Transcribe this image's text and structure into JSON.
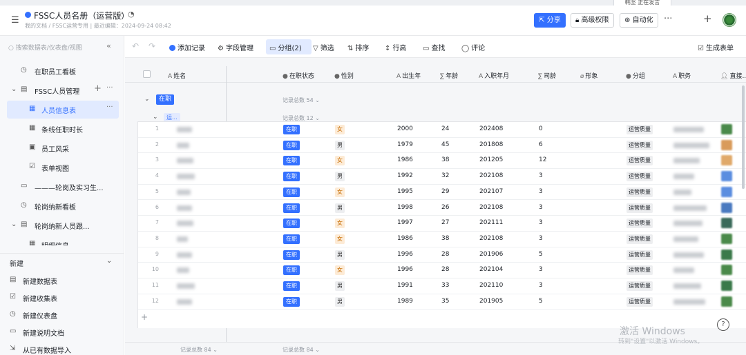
{
  "toast": "韩坚 正在发言",
  "header": {
    "title": "FSSC人员名册（运营版）",
    "breadcrumb": "我的文档 / FSSC运营专用  |  最近编辑：2024-09-24 08:42",
    "share_label": "分享",
    "advanced_perm_label": "高级权限",
    "automation_label": "自动化"
  },
  "sidebar": {
    "search_placeholder": "搜索数据表/仪表盘/视图",
    "items": [
      {
        "label": "在职员工看板",
        "icon": "dashboard-icon"
      },
      {
        "label": "FSSC人员管理",
        "icon": "table-icon"
      },
      {
        "label": "人员信息表",
        "icon": "grid-icon"
      },
      {
        "label": "条线任职时长",
        "icon": "grid-icon"
      },
      {
        "label": "员工风采",
        "icon": "gallery-icon"
      },
      {
        "label": "表单视图",
        "icon": "form-icon"
      },
      {
        "label": "———轮岗及实习生...",
        "icon": "doc-icon"
      },
      {
        "label": "轮岗纳新看板",
        "icon": "dashboard-icon"
      },
      {
        "label": "轮岗纳新人员跟...",
        "icon": "table-icon"
      },
      {
        "label": "明细信息",
        "icon": "grid-icon"
      }
    ],
    "new_section": "新建",
    "new_items": [
      {
        "label": "新建数据表"
      },
      {
        "label": "新建收集表"
      },
      {
        "label": "新建仪表盘"
      },
      {
        "label": "新建说明文档"
      },
      {
        "label": "从已有数据导入"
      }
    ]
  },
  "toolbar": {
    "add_record": "添加记录",
    "field_manage": "字段管理",
    "group": "分组(2)",
    "filter": "筛选",
    "sort": "排序",
    "row_height": "行高",
    "find": "查找",
    "comment": "评论",
    "generate_form": "生成表单"
  },
  "columns": {
    "name": "姓名",
    "status": "在职状态",
    "gender": "性别",
    "birth_year": "出生年",
    "age": "年龄",
    "join_month": "入职年月",
    "tenure": "司龄",
    "image": "形象",
    "group": "分组",
    "title": "职务",
    "leader": "直接..."
  },
  "group1": {
    "tag": "在职",
    "count": "记录总数 54"
  },
  "group2": {
    "tag": "运...",
    "count": "记录总数 12"
  },
  "rows": [
    {
      "n": "1",
      "status": "在职",
      "gender": "女",
      "birth": "2000",
      "age": "24",
      "join": "202408",
      "tenure": "0",
      "dept": "运营质量"
    },
    {
      "n": "2",
      "status": "在职",
      "gender": "男",
      "birth": "1979",
      "age": "45",
      "join": "201808",
      "tenure": "6",
      "dept": "运营质量"
    },
    {
      "n": "3",
      "status": "在职",
      "gender": "女",
      "birth": "1986",
      "age": "38",
      "join": "201205",
      "tenure": "12",
      "dept": "运营质量"
    },
    {
      "n": "4",
      "status": "在职",
      "gender": "男",
      "birth": "1992",
      "age": "32",
      "join": "202108",
      "tenure": "3",
      "dept": "运营质量"
    },
    {
      "n": "5",
      "status": "在职",
      "gender": "女",
      "birth": "1995",
      "age": "29",
      "join": "202107",
      "tenure": "3",
      "dept": "运营质量"
    },
    {
      "n": "6",
      "status": "在职",
      "gender": "男",
      "birth": "1998",
      "age": "26",
      "join": "202108",
      "tenure": "3",
      "dept": "运营质量"
    },
    {
      "n": "7",
      "status": "在职",
      "gender": "女",
      "birth": "1997",
      "age": "27",
      "join": "202111",
      "tenure": "3",
      "dept": "运营质量"
    },
    {
      "n": "8",
      "status": "在职",
      "gender": "女",
      "birth": "1986",
      "age": "38",
      "join": "202108",
      "tenure": "3",
      "dept": "运营质量"
    },
    {
      "n": "9",
      "status": "在职",
      "gender": "男",
      "birth": "1996",
      "age": "28",
      "join": "201906",
      "tenure": "5",
      "dept": "运营质量"
    },
    {
      "n": "10",
      "status": "在职",
      "gender": "女",
      "birth": "1996",
      "age": "28",
      "join": "202104",
      "tenure": "3",
      "dept": "运营质量"
    },
    {
      "n": "11",
      "status": "在职",
      "gender": "男",
      "birth": "1991",
      "age": "33",
      "join": "202110",
      "tenure": "3",
      "dept": "运营质量"
    },
    {
      "n": "12",
      "status": "在职",
      "gender": "男",
      "birth": "1989",
      "age": "35",
      "join": "201905",
      "tenure": "5",
      "dept": "运营质量"
    }
  ],
  "footer": {
    "left_count": "记录总数 84",
    "right_count": "记录总数 84"
  },
  "watermark": {
    "line1": "激活 Windows",
    "line2": "转到\"设置\"以激活 Windows。"
  },
  "colors": {
    "accent": "#3370ff",
    "female_tag": "#fdebd6",
    "male_tag": "#edeef0"
  }
}
